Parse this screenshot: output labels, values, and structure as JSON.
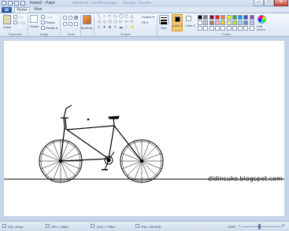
{
  "window": {
    "title": "frame2 - Paint",
    "background_tabs": [
      "Windows Live Messenger",
      "Google Chrome"
    ],
    "controls": [
      "–",
      "□",
      "✕"
    ]
  },
  "tabs": [
    {
      "label": "Home",
      "active": true
    },
    {
      "label": "View",
      "active": false
    }
  ],
  "ribbon": {
    "clipboard": {
      "label": "Clipboard",
      "paste": "Paste",
      "cut": "Cut",
      "copy": "Copy"
    },
    "image": {
      "label": "Image",
      "select": "Select",
      "crop": "Crop",
      "resize": "Resize",
      "rotate": "Rotate ▾"
    },
    "tools": {
      "label": "Tools"
    },
    "brushes": {
      "label": "Brushes"
    },
    "shapes": {
      "label": "Shapes",
      "outline": "Outline ▾",
      "fill": "Fill ▾",
      "cells": [
        "╲",
        "○",
        "□",
        "▭",
        "◯",
        "▢",
        "△",
        "◁",
        "◇",
        "⬠",
        "⬡",
        "▷",
        "⇦",
        "⇧",
        "⇩",
        "✦",
        "★",
        "✧",
        "☁",
        "♡",
        "⚡"
      ]
    },
    "size": {
      "label": "Size"
    },
    "color1": {
      "label": "Color 1"
    },
    "color2": {
      "label": "Color 2"
    },
    "colors": {
      "label": "Colors",
      "edit": "Edit colors",
      "row1": [
        "#000000",
        "#7f7f7f",
        "#880015",
        "#ed1c24",
        "#ff7f27",
        "#fff200",
        "#22b14c",
        "#00a2e8",
        "#3f48cc",
        "#a349a4"
      ],
      "row2": [
        "#ffffff",
        "#c3c3c3",
        "#b97a57",
        "#ffaec9",
        "#ffc90e",
        "#efe4b0",
        "#b5e61d",
        "#99d9ea",
        "#7092be",
        "#c8bfe7"
      ],
      "row3": [
        "#ffffff",
        "#ffffff",
        "#ffffff",
        "#ffffff",
        "#ffffff",
        "#ffffff",
        "#ffffff",
        "#ffffff",
        "#ffffff",
        "#ffffff"
      ]
    }
  },
  "canvas": {
    "watermark": "didinsuko.blogspot.com"
  },
  "status": {
    "cursor": "256, 161px",
    "selection": "150 × 166px",
    "dimensions": "1262 × 798px",
    "filesize": "Size: 106.0KB",
    "zoom": "100%"
  }
}
